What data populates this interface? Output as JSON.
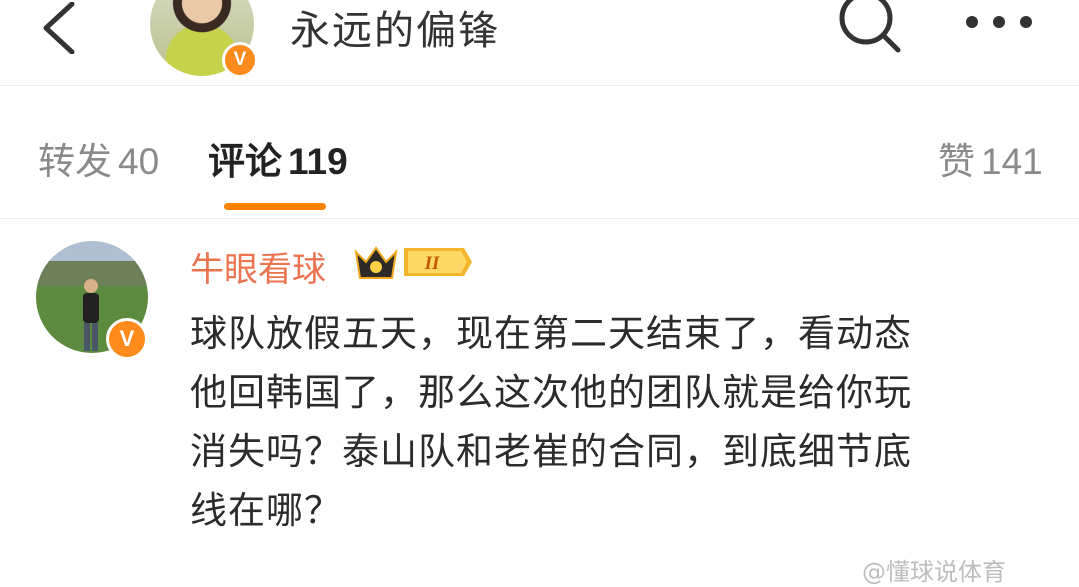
{
  "header": {
    "title": "永远的偏锋",
    "verified_badge": "V",
    "icons": [
      "back-icon",
      "search-icon",
      "more-icon"
    ]
  },
  "tabs": {
    "repost": {
      "label": "转发",
      "count": "40"
    },
    "comment": {
      "label": "评论",
      "count": "119"
    },
    "like": {
      "label": "赞",
      "count": "141"
    }
  },
  "comment": {
    "username": "牛眼看球",
    "verified_badge": "V",
    "fan_level": "II",
    "lines": [
      "球队放假五天，现在第二天结束了，看动态",
      "他回韩国了，那么这次他的团队就是给你玩",
      "消失吗？泰山队和老崔的合同，到底细节底",
      "线在哪？"
    ]
  },
  "watermark": "@懂球说体育",
  "colors": {
    "accent": "#ff8200",
    "username": "#eb7350",
    "verified": "#ff8b1c"
  }
}
